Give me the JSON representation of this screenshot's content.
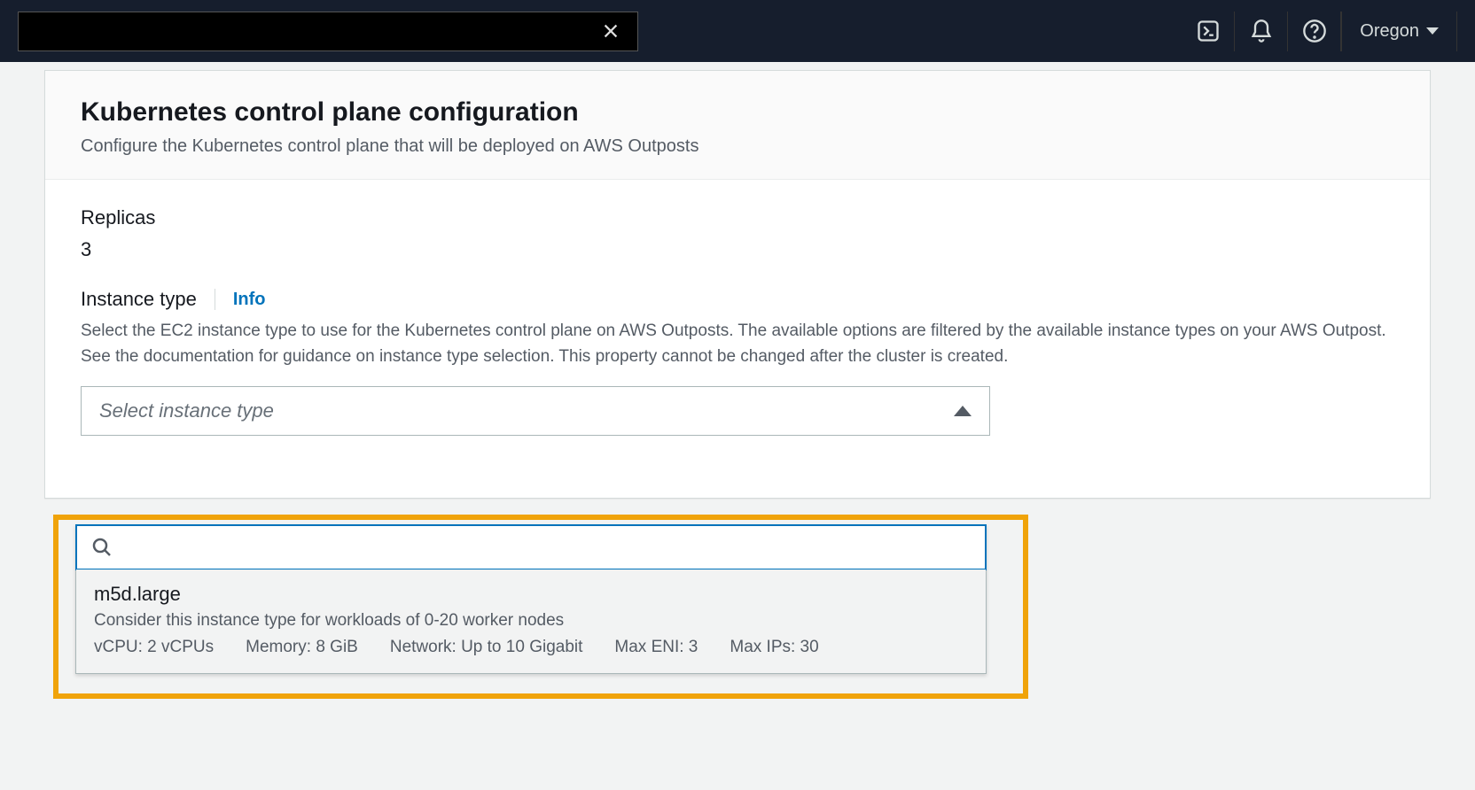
{
  "nav": {
    "region": "Oregon"
  },
  "panel": {
    "title": "Kubernetes control plane configuration",
    "subtitle": "Configure the Kubernetes control plane that will be deployed on AWS Outposts"
  },
  "replicas": {
    "label": "Replicas",
    "value": "3"
  },
  "instance_type": {
    "label": "Instance type",
    "info": "Info",
    "description": "Select the EC2 instance type to use for the Kubernetes control plane on AWS Outposts. The available options are filtered by the available instance types on your AWS Outpost. See the documentation for guidance on instance type selection. This property cannot be changed after the cluster is created.",
    "placeholder": "Select instance type"
  },
  "dropdown": {
    "search_value": "",
    "option": {
      "name": "m5d.large",
      "hint": "Consider this instance type for workloads of 0-20 worker nodes",
      "vcpu": "vCPU: 2 vCPUs",
      "memory": "Memory: 8 GiB",
      "network": "Network: Up to 10 Gigabit",
      "max_eni": "Max ENI: 3",
      "max_ips": "Max IPs: 30"
    }
  }
}
